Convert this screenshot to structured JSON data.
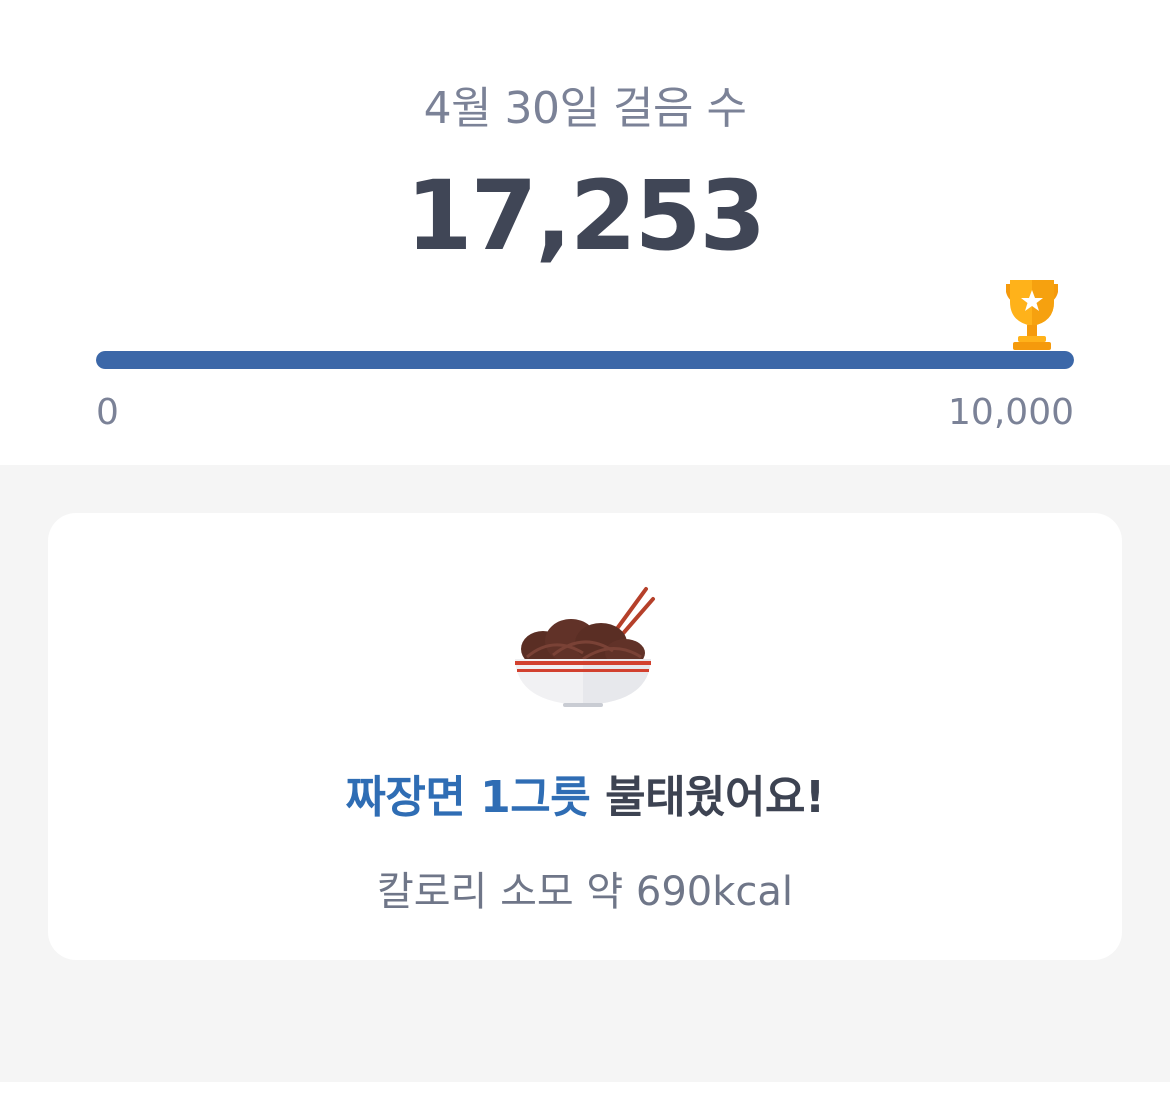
{
  "header": {
    "date_title": "4월 30일 걸음 수",
    "steps": "17,253"
  },
  "progress": {
    "min_label": "0",
    "max_label": "10,000",
    "fill_fraction": 1.0,
    "goal_icon": "trophy-icon",
    "fill_color": "#3b67a8"
  },
  "card": {
    "food_icon": "jjajangmyeon-bowl-icon",
    "headline_highlight": "짜장면 1그릇",
    "headline_rest": " 불태웠어요!",
    "calorie_text": "칼로리 소모 약 690kcal",
    "highlight_color": "#2f6db4"
  }
}
